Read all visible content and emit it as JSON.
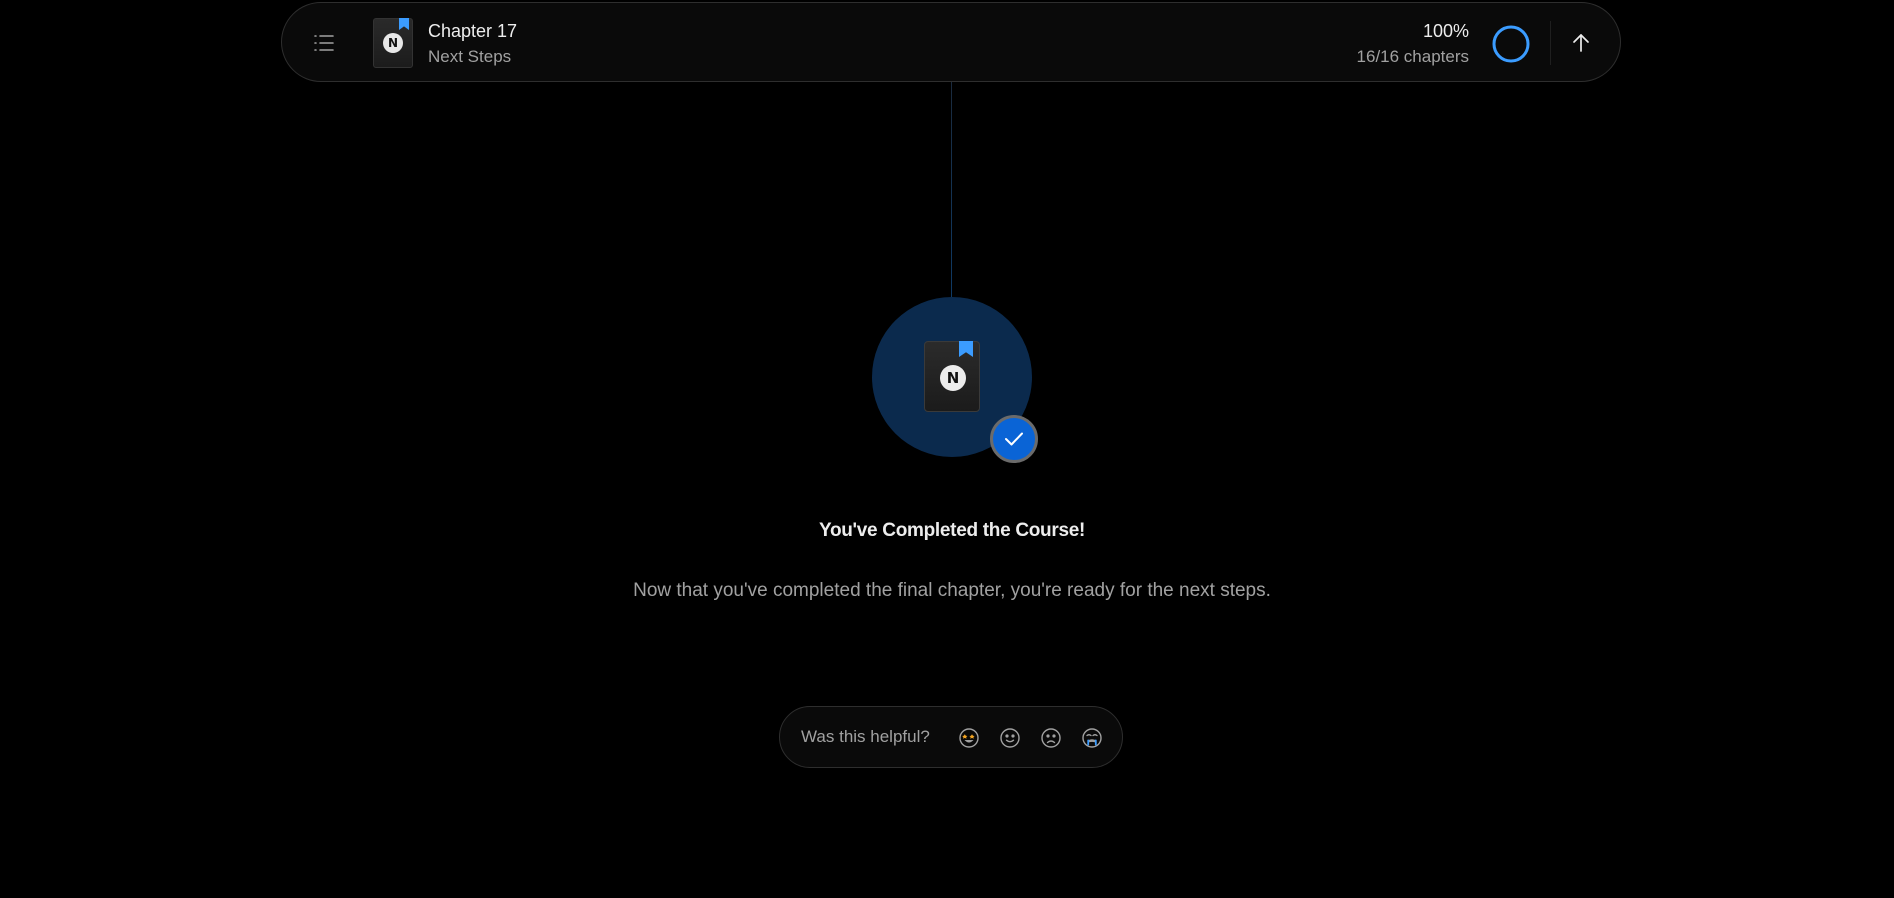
{
  "header": {
    "chapter_title": "Chapter 17",
    "chapter_subtitle": "Next Steps",
    "book_logo": "N",
    "progress_percent": "100%",
    "progress_chapters": "16/16 chapters",
    "progress_value": 1.0,
    "menu_icon": "list-icon",
    "scroll_top_icon": "arrow-up-icon"
  },
  "completion": {
    "book_logo": "N",
    "title": "You've Completed the Course!",
    "description": "Now that you've completed the final chapter, you're ready for the next steps.",
    "badge_icon": "checkmark-icon"
  },
  "feedback": {
    "label": "Was this helpful?",
    "options": [
      {
        "name": "star-eyes-emoji-icon"
      },
      {
        "name": "smile-emoji-icon"
      },
      {
        "name": "frown-emoji-icon"
      },
      {
        "name": "crying-emoji-icon"
      }
    ]
  },
  "colors": {
    "background": "#000000",
    "accent": "#3b9cff",
    "badge_circle": "#0b2a4d",
    "check_badge": "#0a64d6",
    "text_primary": "#ededed",
    "text_secondary": "#a1a1a1"
  }
}
